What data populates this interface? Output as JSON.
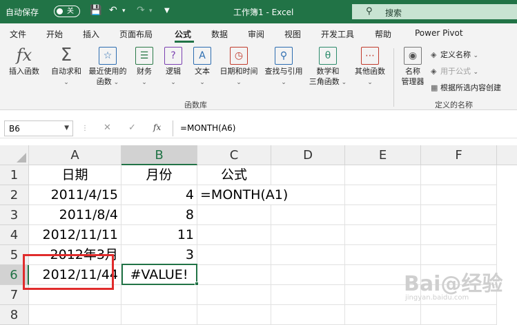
{
  "titlebar": {
    "autosave_label": "自动保存",
    "toggle_state": "关",
    "doc_title": "工作簿1  -  Excel",
    "search_placeholder": "搜索"
  },
  "tabs": [
    "文件",
    "开始",
    "插入",
    "页面布局",
    "公式",
    "数据",
    "审阅",
    "视图",
    "开发工具",
    "帮助",
    "Power Pivot"
  ],
  "active_tab": "公式",
  "ribbon": {
    "insert_function": "插入函数",
    "autosum": "自动求和",
    "recent_line1": "最近使用的",
    "recent_line2": "函数",
    "financial": "财务",
    "logical": "逻辑",
    "text": "文本",
    "datetime": "日期和时间",
    "lookup": "查找与引用",
    "math_line1": "数学和",
    "math_line2": "三角函数",
    "more": "其他函数",
    "library_group": "函数库",
    "name_manager_line1": "名称",
    "name_manager_line2": "管理器",
    "define_name": "定义名称",
    "use_in_formula": "用于公式",
    "create_from_selection": "根据所选内容创建",
    "names_group": "定义的名称"
  },
  "formula_bar": {
    "name_box": "B6",
    "fx": "fx",
    "formula": "=MONTH(A6)"
  },
  "sheet": {
    "columns": [
      "A",
      "B",
      "C",
      "D",
      "E",
      "F"
    ],
    "rows": [
      "1",
      "2",
      "3",
      "4",
      "5",
      "6",
      "7",
      "8"
    ],
    "cells": {
      "A1": "日期",
      "B1": "月份",
      "C1": "公式",
      "A2": "2011/4/15",
      "B2": "4",
      "C2": "=MONTH(A1)",
      "A3": "2011/8/4",
      "B3": "8",
      "A4": "2012/11/11",
      "B4": "11",
      "A5": "2012年3月",
      "B5": "3",
      "A6": "2012/11/44",
      "B6": "#VALUE!"
    },
    "selected_cell": "B6"
  },
  "watermark": {
    "main": "Bai@经验",
    "sub": "jingyan.baidu.com"
  }
}
